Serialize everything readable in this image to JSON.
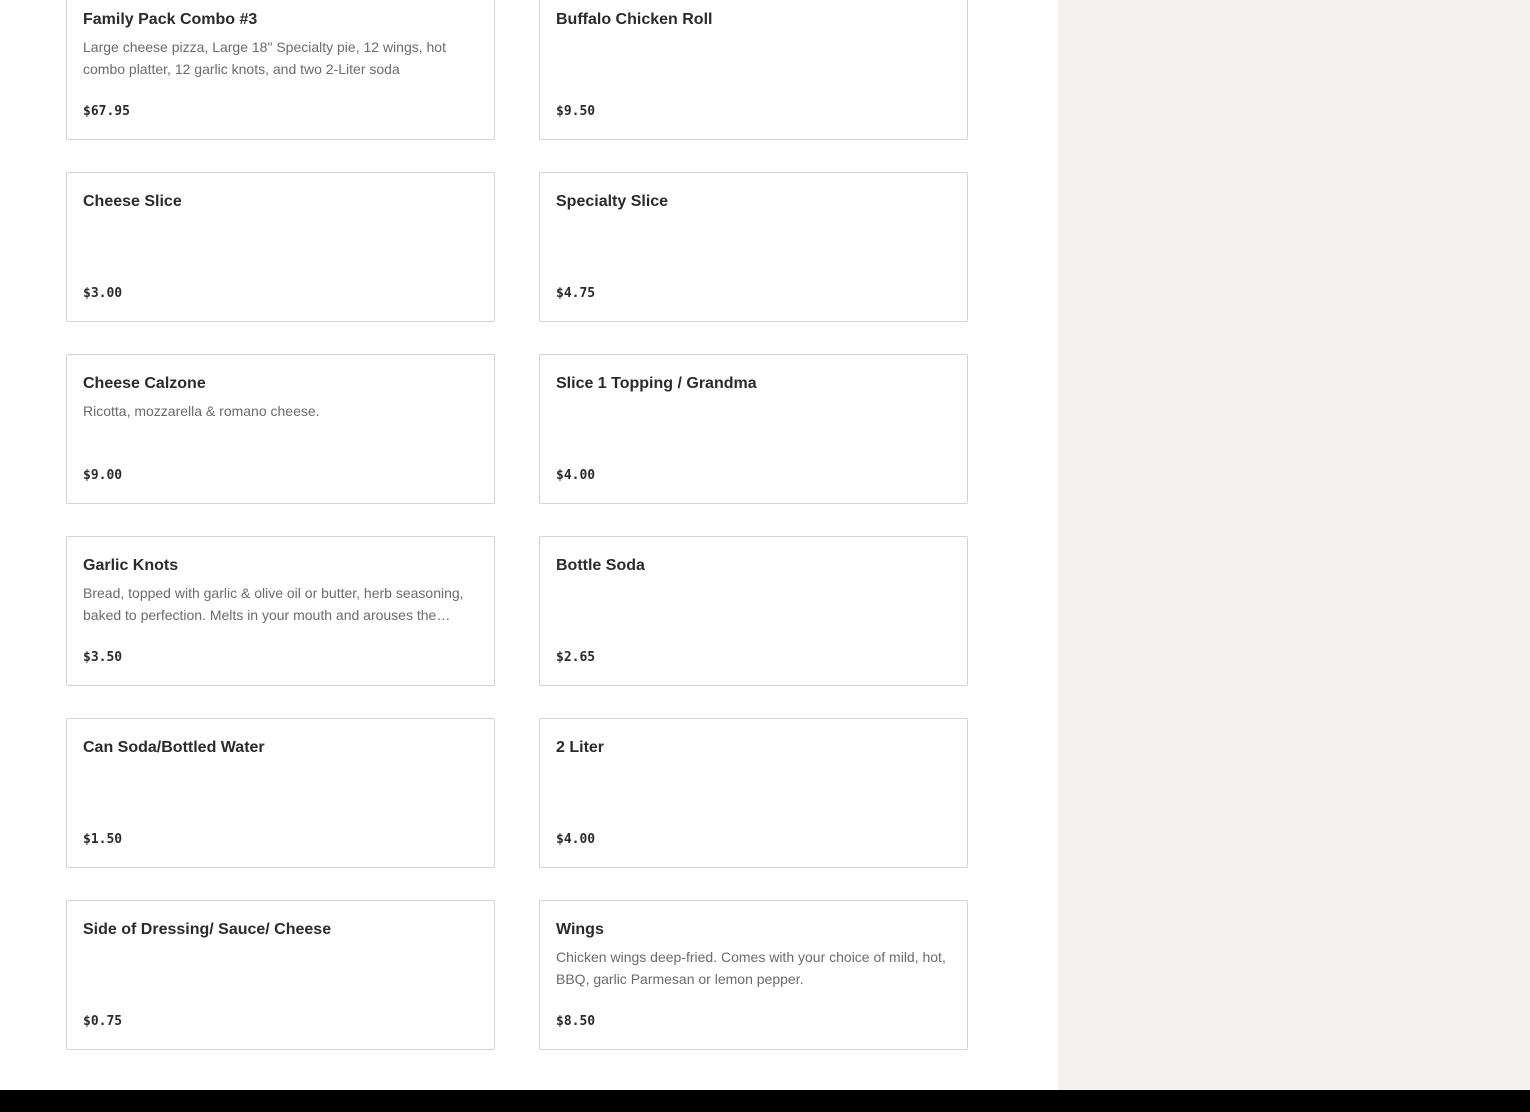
{
  "menu": {
    "items": [
      {
        "name": "Family Pack Combo #3",
        "description": "Large cheese pizza, Large 18\" Specialty pie, 12 wings, hot combo platter, 12 garlic knots, and two 2-Liter soda",
        "price": "$67.95"
      },
      {
        "name": "Buffalo Chicken Roll",
        "description": "",
        "price": "$9.50"
      },
      {
        "name": "Cheese Slice",
        "description": "",
        "price": "$3.00"
      },
      {
        "name": "Specialty Slice",
        "description": "",
        "price": "$4.75"
      },
      {
        "name": "Cheese Calzone",
        "description": "Ricotta, mozzarella & romano cheese.",
        "price": "$9.00"
      },
      {
        "name": "Slice 1 Topping / Grandma",
        "description": "",
        "price": "$4.00"
      },
      {
        "name": "Garlic Knots",
        "description": "Bread, topped with garlic & olive oil or butter, herb seasoning, baked to perfection. Melts in your mouth and arouses the senses.",
        "price": "$3.50"
      },
      {
        "name": "Bottle Soda",
        "description": "",
        "price": "$2.65"
      },
      {
        "name": "Can Soda/Bottled Water",
        "description": "",
        "price": "$1.50"
      },
      {
        "name": "2 Liter",
        "description": "",
        "price": "$4.00"
      },
      {
        "name": "Side of Dressing/ Sauce/ Cheese",
        "description": "",
        "price": "$0.75"
      },
      {
        "name": "Wings",
        "description": "Chicken wings deep-fried. Comes with your choice of mild, hot, BBQ, garlic Parmesan or lemon pepper.",
        "price": "$8.50"
      }
    ]
  },
  "colors": {
    "sidebar_bg": "#f3f2ef",
    "footer_bg": "#000000",
    "card_border": "#d4d4d4",
    "title_text": "#2b2b2b",
    "desc_text": "#6b6b6b"
  }
}
